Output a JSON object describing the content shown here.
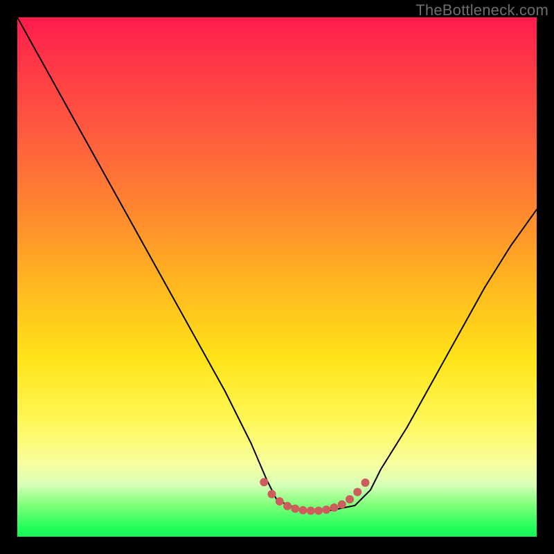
{
  "watermark": "TheBottleneck.com",
  "colors": {
    "frame": "#000000",
    "curve": "#000000",
    "marker": "#cd5c5c",
    "watermark": "#6d6d6d"
  },
  "chart_data": {
    "type": "line",
    "title": "",
    "xlabel": "",
    "ylabel": "",
    "xlim": [
      0,
      100
    ],
    "ylim": [
      0,
      100
    ],
    "grid": false,
    "legend": false,
    "note": "Values are read off the rendered figure in percent of plot width/height; y=0 is bottom, y=100 is top. Left branch starts near top-left and descends into a flat trough around x≈50–65, right branch rises toward upper-right.",
    "series": [
      {
        "name": "curve",
        "x": [
          0,
          5,
          10,
          15,
          20,
          25,
          30,
          35,
          40,
          45,
          48,
          50,
          55,
          60,
          65,
          68,
          70,
          75,
          80,
          85,
          90,
          95,
          100
        ],
        "y": [
          100,
          91,
          82,
          73,
          64,
          55,
          46,
          37,
          28,
          18,
          11,
          7,
          5,
          5,
          6,
          9,
          13,
          21,
          30,
          39,
          48,
          56,
          63
        ]
      }
    ],
    "markers": {
      "name": "trough-highlight",
      "color": "#cd5c5c",
      "approx_radius_px": 6,
      "x": [
        47.5,
        49,
        50.5,
        52,
        53.5,
        55,
        56.5,
        58,
        59.5,
        61,
        62.5,
        64,
        65.5,
        67
      ],
      "y": [
        10.5,
        8.2,
        6.8,
        5.9,
        5.4,
        5.1,
        5.0,
        5.0,
        5.2,
        5.6,
        6.2,
        7.2,
        8.6,
        10.4
      ]
    }
  }
}
